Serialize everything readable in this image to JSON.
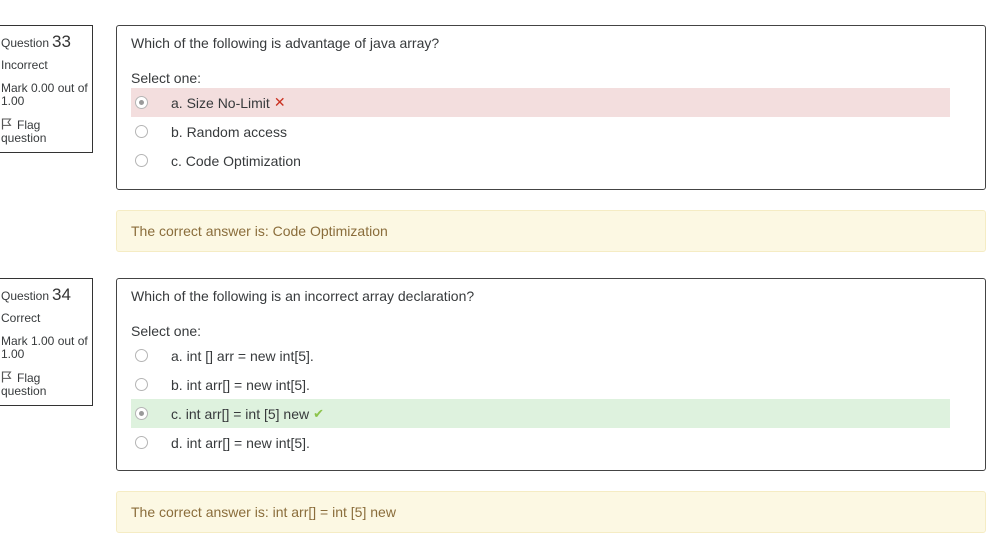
{
  "questions": [
    {
      "label": "Question",
      "number": "33",
      "state": "Incorrect",
      "grade": "Mark 0.00 out of 1.00",
      "flag_label": "Flag question",
      "text": "Which of the following is advantage of java array?",
      "prompt": "Select one:",
      "options": [
        {
          "label": "a. Size No-Limit",
          "checked": true,
          "result": "incorrect"
        },
        {
          "label": "b. Random access",
          "checked": false,
          "result": ""
        },
        {
          "label": "c. Code Optimization",
          "checked": false,
          "result": ""
        }
      ],
      "feedback": "The correct answer is: Code Optimization"
    },
    {
      "label": "Question",
      "number": "34",
      "state": "Correct",
      "grade": "Mark 1.00 out of 1.00",
      "flag_label": "Flag question",
      "text": "Which of the following is an incorrect array declaration?",
      "prompt": "Select one:",
      "options": [
        {
          "label": "a. int [] arr = new int[5].",
          "checked": false,
          "result": ""
        },
        {
          "label": "b. int arr[] = new int[5].",
          "checked": false,
          "result": ""
        },
        {
          "label": "c. int arr[] = int [5] new",
          "checked": true,
          "result": "correct"
        },
        {
          "label": "d. int arr[] = new int[5].",
          "checked": false,
          "result": ""
        }
      ],
      "feedback": "The correct answer is: int arr[] = int [5] new"
    }
  ],
  "icons": {
    "incorrect": "cross-icon",
    "correct": "check-icon",
    "flag": "flag-icon"
  },
  "colors": {
    "incorrect_bg": "#f3dede",
    "correct_bg": "#def2de",
    "feedback_bg": "#fcf8e3",
    "feedback_text": "#8a6d3b",
    "cross": "#ca3120",
    "check": "#8bc34a"
  }
}
